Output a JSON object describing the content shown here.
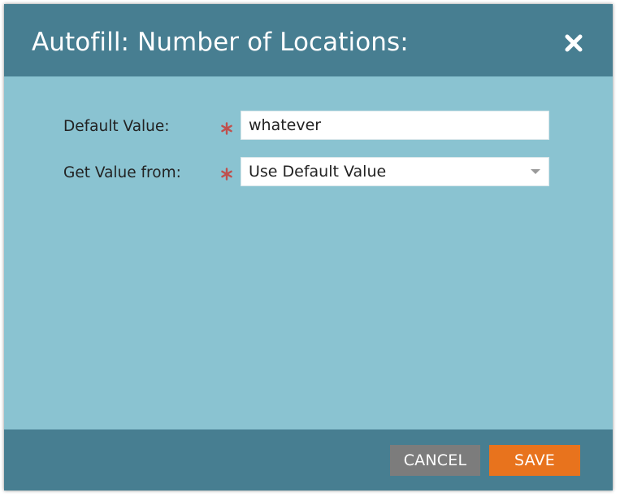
{
  "dialog": {
    "title": "Autofill: Number of Locations:",
    "close_icon": "close-x-icon"
  },
  "form": {
    "default_value": {
      "label": "Default Value:",
      "required": true,
      "value": "whatever"
    },
    "get_value_from": {
      "label": "Get Value from:",
      "required": true,
      "selected": "Use Default Value"
    }
  },
  "footer": {
    "cancel_label": "CANCEL",
    "save_label": "SAVE"
  },
  "colors": {
    "header_footer": "#477e91",
    "body": "#8ac3d1",
    "required_asterisk": "#c0504d",
    "cancel_button": "#7c7c7c",
    "save_button": "#e8731d"
  }
}
